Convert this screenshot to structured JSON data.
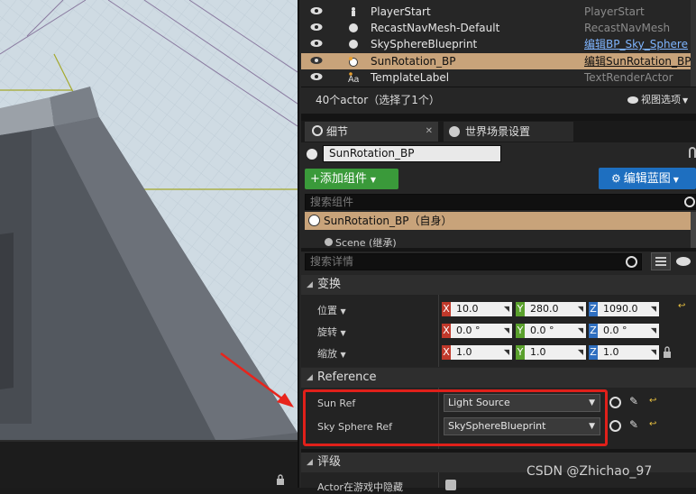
{
  "outliner": {
    "rows": [
      {
        "name": "PlayerStart",
        "type": "PlayerStart",
        "selected": false,
        "link": false,
        "icon": "player-start-icon"
      },
      {
        "name": "RecastNavMesh-Default",
        "type": "RecastNavMesh",
        "selected": false,
        "link": false,
        "icon": "sphere-icon"
      },
      {
        "name": "SkySphereBlueprint",
        "type": "编辑BP_Sky_Sphere",
        "selected": false,
        "link": true,
        "icon": "sphere-icon"
      },
      {
        "name": "SunRotation_BP",
        "type": "编辑SunRotation_BP",
        "selected": true,
        "link": true,
        "icon": "actor-icon"
      },
      {
        "name": "TemplateLabel",
        "type": "TextRenderActor",
        "selected": false,
        "link": false,
        "icon": "text-icon"
      }
    ],
    "status": "40个actor（选择了1个）",
    "view_options": "视图选项"
  },
  "tabs": {
    "details": "细节",
    "world_settings": "世界场景设置"
  },
  "details": {
    "actor_name": "SunRotation_BP",
    "add_component": "+添加组件",
    "edit_blueprint": "编辑蓝图",
    "search_components_placeholder": "搜索组件",
    "self_component": "SunRotation_BP（自身）",
    "scene_component": "Scene (继承)",
    "search_details_placeholder": "搜索详情"
  },
  "transform": {
    "title": "变换",
    "location": {
      "label": "位置",
      "x": "10.0",
      "y": "280.0",
      "z": "1090.0"
    },
    "rotation": {
      "label": "旋转",
      "x": "0.0 °",
      "y": "0.0 °",
      "z": "0.0 °"
    },
    "scale": {
      "label": "缩放",
      "x": "1.0",
      "y": "1.0",
      "z": "1.0"
    }
  },
  "reference": {
    "title": "Reference",
    "sun_ref": {
      "label": "Sun Ref",
      "value": "Light Source"
    },
    "sky_ref": {
      "label": "Sky Sphere Ref",
      "value": "SkySphereBlueprint"
    }
  },
  "rendering": {
    "title": "评级",
    "hidden_label": "Actor在游戏中隐藏"
  },
  "watermark": "CSDN @Zhichao_97",
  "colors": {
    "selection": "#c8a37a",
    "add_component_green": "#3a9a3a",
    "edit_blueprint_blue": "#1e6fc0",
    "highlight_box": "#e0201a",
    "axis_x": "#c0392b",
    "axis_y": "#5aa02c",
    "axis_z": "#2f6fc0"
  }
}
